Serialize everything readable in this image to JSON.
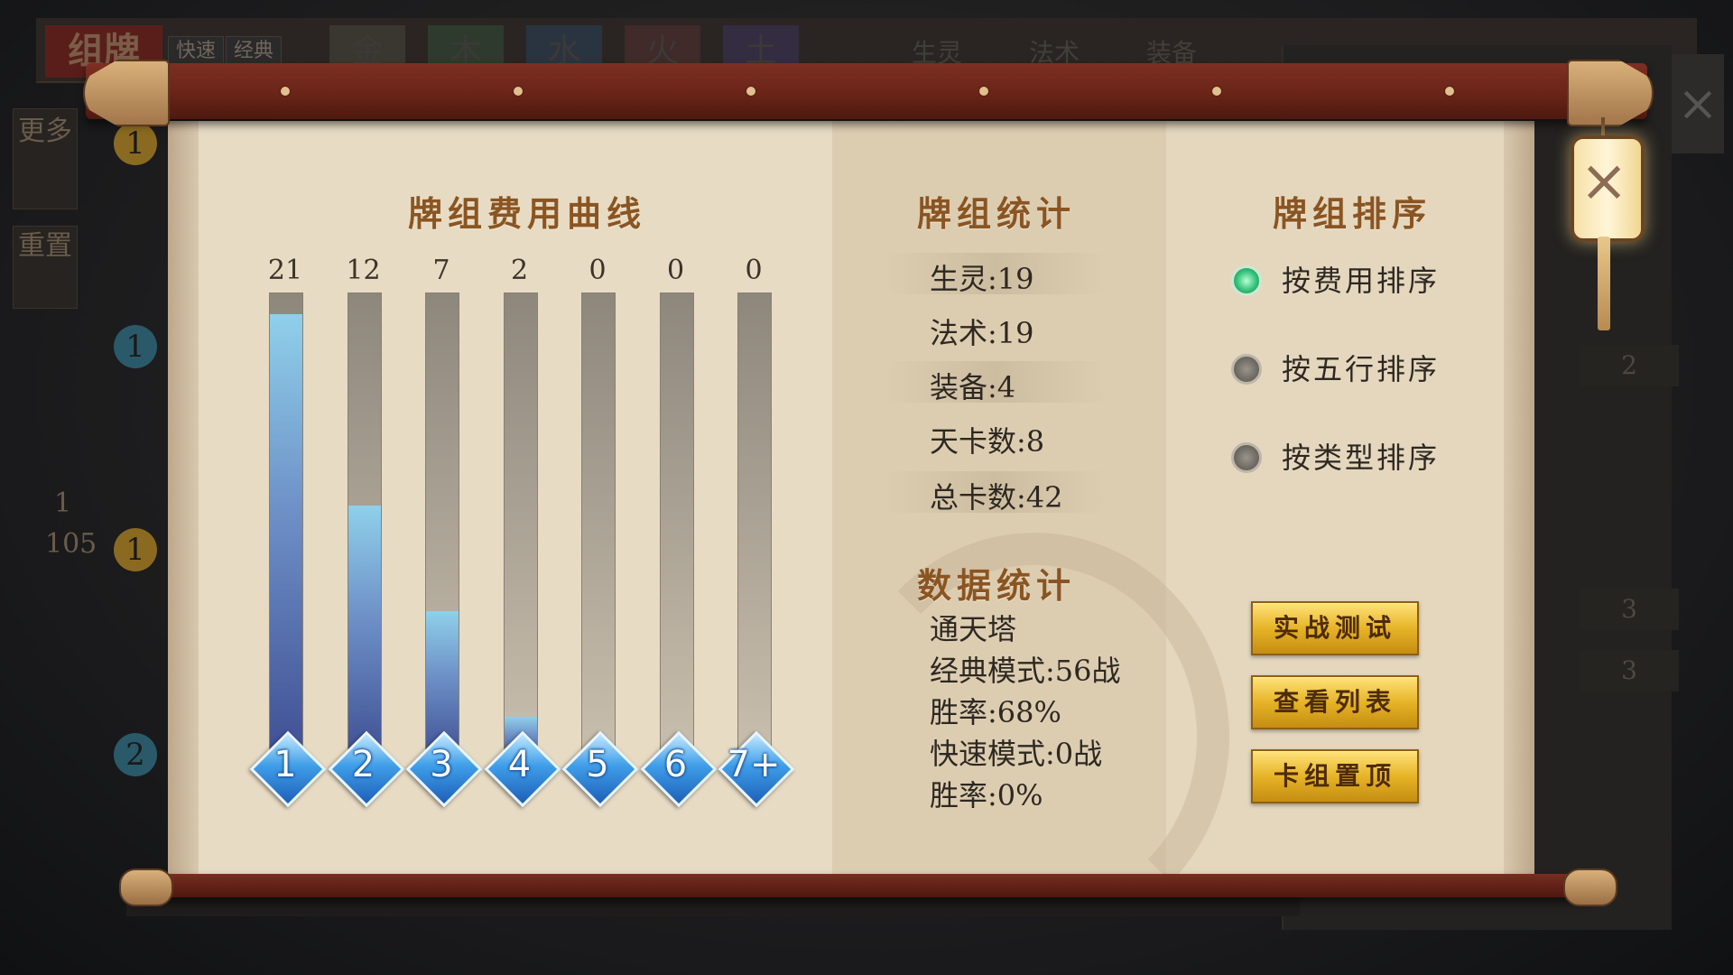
{
  "background": {
    "title": "组牌",
    "quick_label": "快速",
    "classic_label": "经典",
    "element_tabs": [
      "金",
      "木",
      "水",
      "火",
      "土"
    ],
    "filters": [
      "生灵",
      "法术",
      "装备"
    ],
    "side_buttons": [
      "更多",
      "重置"
    ],
    "page_indicator": [
      "1",
      "105"
    ],
    "row_costs": [
      "1",
      "1",
      "1",
      "2"
    ],
    "right_counts": [
      "2",
      "3",
      "3"
    ]
  },
  "cost_curve": {
    "title": "牌组费用曲线"
  },
  "chart_data": {
    "type": "bar",
    "title": "牌组费用曲线",
    "categories": [
      "1",
      "2",
      "3",
      "4",
      "5",
      "6",
      "7+"
    ],
    "values": [
      21,
      12,
      7,
      2,
      0,
      0,
      0
    ],
    "ylim": [
      0,
      22
    ]
  },
  "deck_stats": {
    "title": "牌组统计",
    "items": [
      "生灵:19",
      "法术:19",
      "装备:4",
      "天卡数:8",
      "总卡数:42"
    ]
  },
  "data_stats": {
    "title": "数据统计",
    "lines": [
      "通天塔",
      "经典模式:56战",
      "胜率:68%",
      "快速模式:0战",
      "胜率:0%"
    ]
  },
  "sort": {
    "title": "牌组排序",
    "options": [
      "按费用排序",
      "按五行排序",
      "按类型排序"
    ],
    "selected_index": 0
  },
  "actions": [
    "实战测试",
    "查看列表",
    "卡组置顶"
  ],
  "icons": {
    "close": "close-icon"
  },
  "colors": {
    "accent_gold": "#e6b427",
    "heading_brown": "#8a5522",
    "bar_blue": "#6d8fc6",
    "selected_green": "#33c27a"
  }
}
